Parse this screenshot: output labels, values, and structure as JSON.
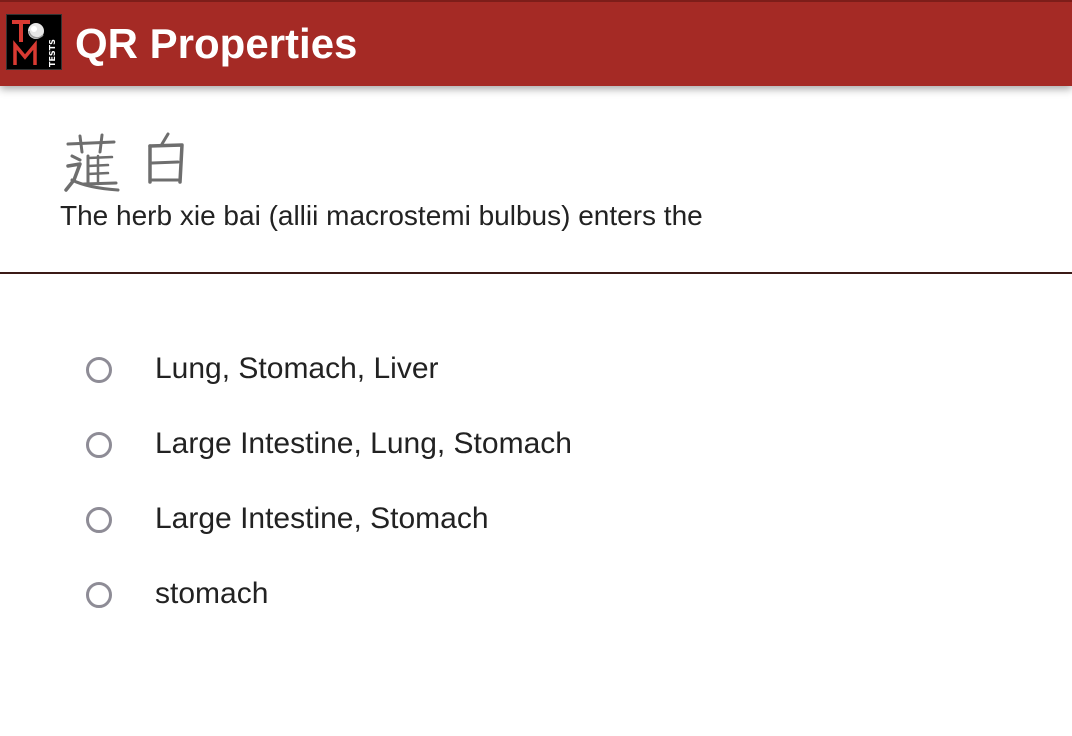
{
  "header": {
    "title": "QR Properties",
    "logo_letters": "TCM TESTS",
    "background_color": "#a52a25"
  },
  "question": {
    "herb_characters": "薤白",
    "text": "The herb xie bai (allii macrostemi bulbus) enters the"
  },
  "options": [
    {
      "label": "Lung, Stomach, Liver",
      "selected": false
    },
    {
      "label": "Large Intestine, Lung, Stomach",
      "selected": false
    },
    {
      "label": "Large Intestine, Stomach",
      "selected": false
    },
    {
      "label": "stomach",
      "selected": false
    }
  ],
  "colors": {
    "radio_border": "#8e8c96",
    "text": "#222222",
    "divider": "#3b1a16"
  }
}
